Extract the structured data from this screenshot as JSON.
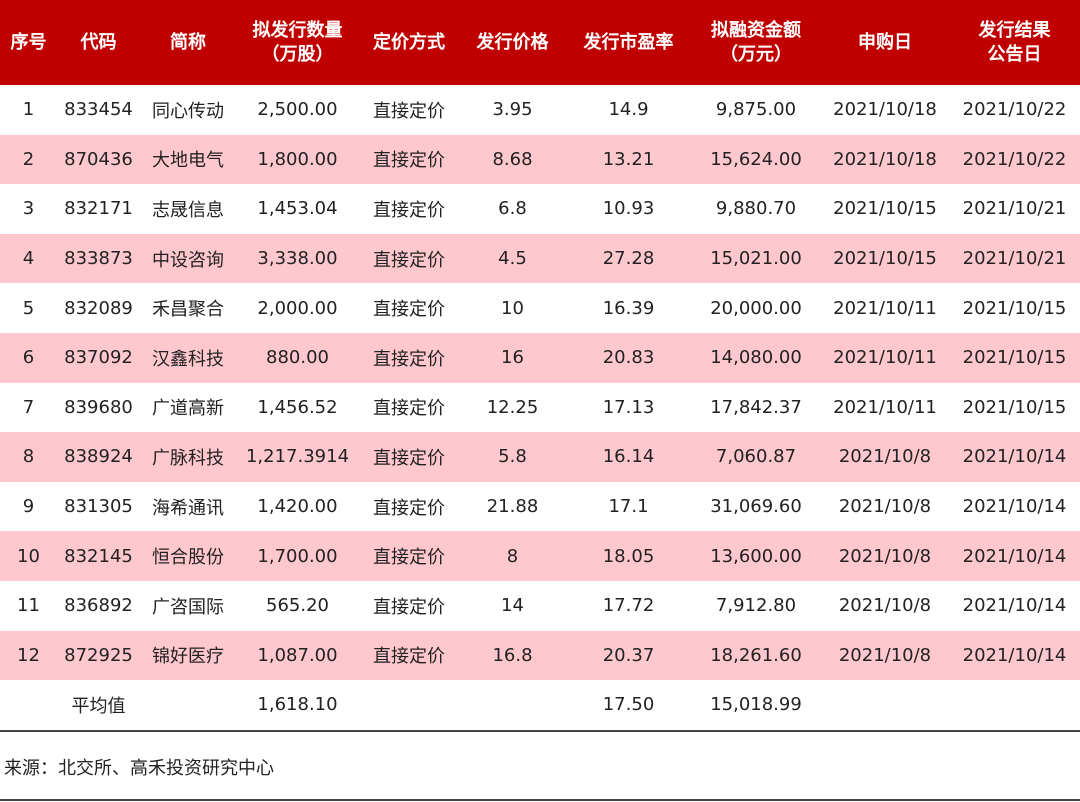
{
  "headers": [
    "序号",
    "代码",
    "简称",
    "拟发行数量\n（万股）",
    "定价方式",
    "发行价格",
    "发行市盈率",
    "拟融资金额\n（万元）",
    "申购日",
    "发行结果\n公告日"
  ],
  "rows": [
    [
      "1",
      "833454",
      "同心传动",
      "2,500.00",
      "直接定价",
      "3.95",
      "14.9",
      "9,875.00",
      "2021/10/18",
      "2021/10/22"
    ],
    [
      "2",
      "870436",
      "大地电气",
      "1,800.00",
      "直接定价",
      "8.68",
      "13.21",
      "15,624.00",
      "2021/10/18",
      "2021/10/22"
    ],
    [
      "3",
      "832171",
      "志晟信息",
      "1,453.04",
      "直接定价",
      "6.8",
      "10.93",
      "9,880.70",
      "2021/10/15",
      "2021/10/21"
    ],
    [
      "4",
      "833873",
      "中设咨询",
      "3,338.00",
      "直接定价",
      "4.5",
      "27.28",
      "15,021.00",
      "2021/10/15",
      "2021/10/21"
    ],
    [
      "5",
      "832089",
      "禾昌聚合",
      "2,000.00",
      "直接定价",
      "10",
      "16.39",
      "20,000.00",
      "2021/10/11",
      "2021/10/15"
    ],
    [
      "6",
      "837092",
      "汉鑫科技",
      "880.00",
      "直接定价",
      "16",
      "20.83",
      "14,080.00",
      "2021/10/11",
      "2021/10/15"
    ],
    [
      "7",
      "839680",
      "广道高新",
      "1,456.52",
      "直接定价",
      "12.25",
      "17.13",
      "17,842.37",
      "2021/10/11",
      "2021/10/15"
    ],
    [
      "8",
      "838924",
      "广脉科技",
      "1,217.3914",
      "直接定价",
      "5.8",
      "16.14",
      "7,060.87",
      "2021/10/8",
      "2021/10/14"
    ],
    [
      "9",
      "831305",
      "海希通讯",
      "1,420.00",
      "直接定价",
      "21.88",
      "17.1",
      "31,069.60",
      "2021/10/8",
      "2021/10/14"
    ],
    [
      "10",
      "832145",
      "恒合股份",
      "1,700.00",
      "直接定价",
      "8",
      "18.05",
      "13,600.00",
      "2021/10/8",
      "2021/10/14"
    ],
    [
      "11",
      "836892",
      "广咨国际",
      "565.20",
      "直接定价",
      "14",
      "17.72",
      "7,912.80",
      "2021/10/8",
      "2021/10/14"
    ],
    [
      "12",
      "872925",
      "锦好医疗",
      "1,087.00",
      "直接定价",
      "16.8",
      "20.37",
      "18,261.60",
      "2021/10/8",
      "2021/10/14"
    ]
  ],
  "average": {
    "label": "平均值",
    "shares": "1,618.10",
    "pe": "17.50",
    "amount": "15,018.99"
  },
  "source": "来源：北交所、高禾投资研究中心",
  "colors": {
    "header_bg": "#c00000",
    "header_text": "#ffffff",
    "stripe_bg": "#ffc7ce"
  }
}
